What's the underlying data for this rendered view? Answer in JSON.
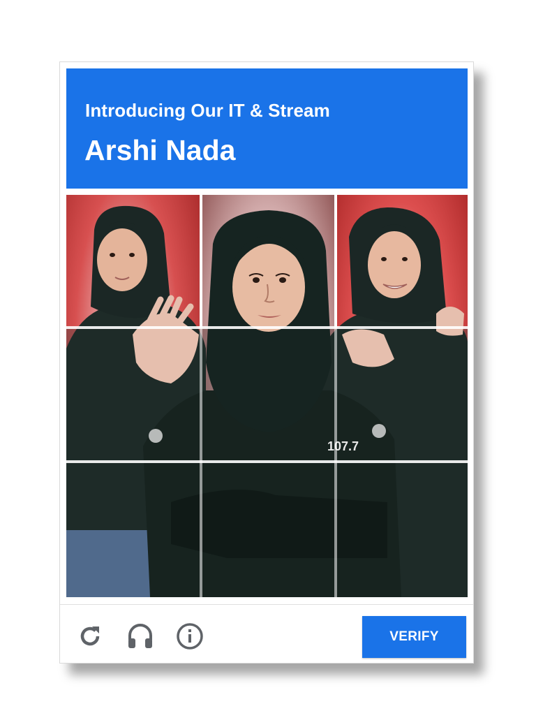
{
  "colors": {
    "accent": "#1a73e8",
    "icon": "#5f6368",
    "backdrop_red": "#d42b2b",
    "garment": "#1b2a26"
  },
  "header": {
    "subtitle": "Introducing Our IT & Stream",
    "title": "Arshi Nada"
  },
  "image": {
    "subject": "person in black hijab and black shirt, arms crossed",
    "badge_text": "107.7"
  },
  "footer": {
    "reload_icon": "reload-icon",
    "audio_icon": "headphones-icon",
    "info_icon": "info-icon",
    "verify_label": "VERIFY"
  }
}
